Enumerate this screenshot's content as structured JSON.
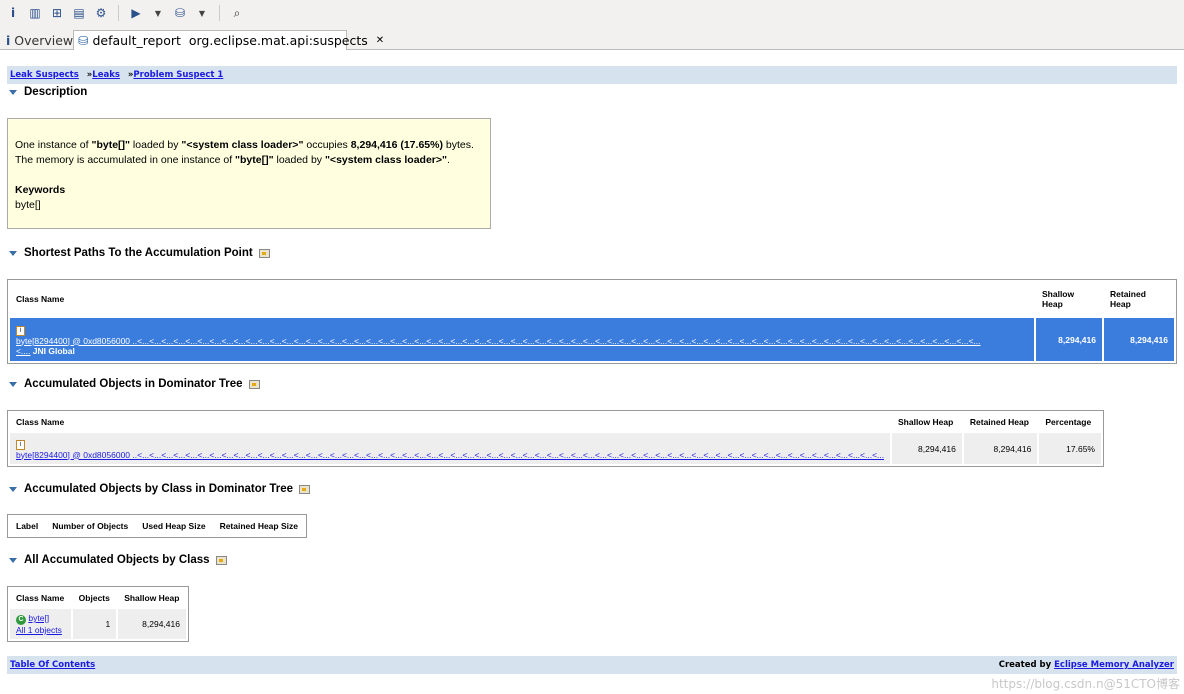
{
  "toolbar": {
    "icons": [
      "info-icon",
      "histogram-icon",
      "dominator-tree-icon",
      "oql-icon",
      "thread-overview-icon",
      "run-query-icon",
      "report-icon",
      "search-icon"
    ]
  },
  "tabs": [
    {
      "label": "Overview",
      "icon": "info-icon"
    },
    {
      "label": "default_report  org.eclipse.mat.api:suspects",
      "icon": "report-icon",
      "active": true
    }
  ],
  "breadcrumb": {
    "items": [
      "Leak Suspects",
      "Leaks",
      "Problem Suspect 1"
    ],
    "sep": "»"
  },
  "description": {
    "heading": "Description",
    "line1": {
      "a": "One instance of ",
      "b": "\"byte[]\"",
      "c": " loaded by ",
      "d": "\"<system class loader>\"",
      "e": " occupies ",
      "f": "8,294,416 (17.65%)",
      "g": " bytes."
    },
    "line2": {
      "a": "The memory is accumulated in one instance of ",
      "b": "\"byte[]\"",
      "c": " loaded by ",
      "d": "\"<system class loader>\"",
      "e": "."
    },
    "keywords_label": "Keywords",
    "keywords": "byte[]"
  },
  "shortest_paths": {
    "heading": "Shortest Paths To the Accumulation Point",
    "columns": [
      "Class Name",
      "Shallow Heap",
      "Retained Heap"
    ],
    "row": {
      "name": "byte[8294400] @ 0xd8056000 ..<...<...<...<...<...<...<...<...<...<...<...<...<...<...<...<...<...<...<...<...<...<...<...<...<...<...<...<...<...<...<...<...<...<...<...<...<...<...<...<...<...<...<...<...<...<...<...<...<...<...<...<...<...<...<...<...<...<...<...<...<...<...<...<...<...<...<...<...<...<...",
      "cont": "<....",
      "root": " JNI Global",
      "shallow": "8,294,416",
      "retained": "8,294,416"
    }
  },
  "dominator": {
    "heading": "Accumulated Objects in Dominator Tree",
    "columns": [
      "Class Name",
      "Shallow Heap",
      "Retained Heap",
      "Percentage"
    ],
    "row": {
      "name": "byte[8294400] @ 0xd8056000 ..<...<...<...<...<...<...<...<...<...<...<...<...<...<...<...<...<...<...<...<...<...<...<...<...<...<...<...<...<...<...<...<...<...<...<...<...<...<...<...<...<...<...<...<...<...<...<...<...<...<...<...<...<...<...<...<...<...<...<...<...<...<...<...<...<...<...",
      "shallow": "8,294,416",
      "retained": "8,294,416",
      "percentage": "17.65%"
    }
  },
  "by_class": {
    "heading": "Accumulated Objects by Class in Dominator Tree",
    "columns": [
      "Label",
      "Number of Objects",
      "Used Heap Size",
      "Retained Heap Size"
    ]
  },
  "all_by_class": {
    "heading": "All Accumulated Objects by Class",
    "columns": [
      "Class Name",
      "Objects",
      "Shallow Heap"
    ],
    "row": {
      "name": "byte[]",
      "all": "All 1 objects",
      "objects": "1",
      "shallow": "8,294,416"
    }
  },
  "footer": {
    "toc": "Table Of Contents",
    "created_by": "Created by ",
    "app": "Eclipse Memory Analyzer"
  },
  "watermark": "https://blog.csdn.n@51CTO博客",
  "colors": {
    "selection": "#3b7ddd",
    "bar": "#d6e3ef",
    "link": "#1a1ae0",
    "description_bg": "#ffffe0"
  }
}
